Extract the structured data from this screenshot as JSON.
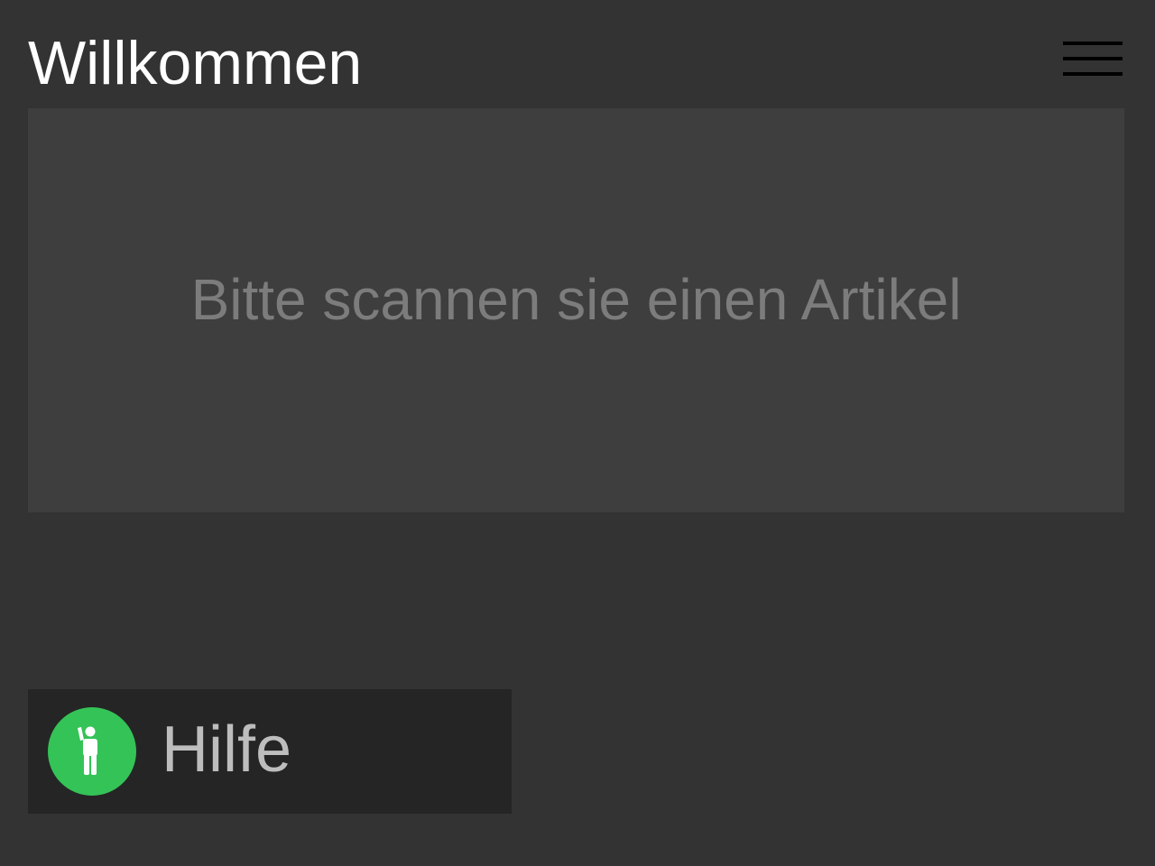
{
  "header": {
    "title": "Willkommen",
    "menu_icon": "hamburger-menu-icon"
  },
  "scan_panel": {
    "prompt": "Bitte scannen sie einen Artikel"
  },
  "help_button": {
    "label": "Hilfe",
    "icon": "person-raising-hand-icon",
    "icon_color": "#34c357"
  },
  "colors": {
    "background": "#333333",
    "panel": "#3e3e3e",
    "help_button_bg": "#252525",
    "title_text": "#ffffff",
    "prompt_text": "#7c7c7c",
    "help_text": "#bdbdbd"
  }
}
